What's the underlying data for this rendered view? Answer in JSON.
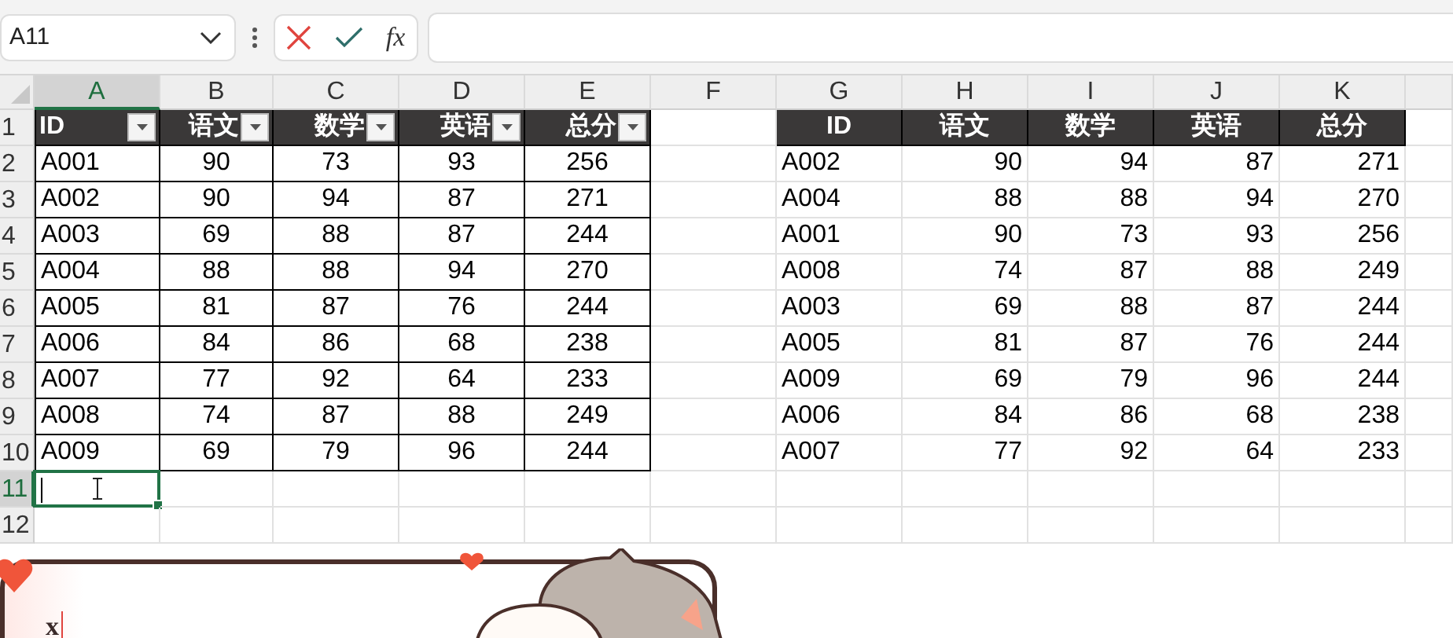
{
  "name_box": {
    "value": "A11"
  },
  "formula_bar": {
    "function_label": "fx"
  },
  "column_headers": [
    {
      "label": "A",
      "selected": true
    },
    {
      "label": "B",
      "selected": false
    },
    {
      "label": "C",
      "selected": false
    },
    {
      "label": "D",
      "selected": false
    },
    {
      "label": "E",
      "selected": false
    },
    {
      "label": "F",
      "selected": false
    },
    {
      "label": "G",
      "selected": false
    },
    {
      "label": "H",
      "selected": false
    },
    {
      "label": "I",
      "selected": false
    },
    {
      "label": "J",
      "selected": false
    },
    {
      "label": "K",
      "selected": false
    }
  ],
  "row_headers": [
    {
      "label": "1",
      "selected": false
    },
    {
      "label": "2",
      "selected": false
    },
    {
      "label": "3",
      "selected": false
    },
    {
      "label": "4",
      "selected": false
    },
    {
      "label": "5",
      "selected": false
    },
    {
      "label": "6",
      "selected": false
    },
    {
      "label": "7",
      "selected": false
    },
    {
      "label": "8",
      "selected": false
    },
    {
      "label": "9",
      "selected": false
    },
    {
      "label": "10",
      "selected": false
    },
    {
      "label": "11",
      "selected": true
    },
    {
      "label": "12",
      "selected": false
    }
  ],
  "score_table": {
    "headers": [
      "ID",
      "语文",
      "数学",
      "英语",
      "总分"
    ],
    "rows": [
      [
        "A001",
        "90",
        "73",
        "93",
        "256"
      ],
      [
        "A002",
        "90",
        "94",
        "87",
        "271"
      ],
      [
        "A003",
        "69",
        "88",
        "87",
        "244"
      ],
      [
        "A004",
        "88",
        "88",
        "94",
        "270"
      ],
      [
        "A005",
        "81",
        "87",
        "76",
        "244"
      ],
      [
        "A006",
        "84",
        "86",
        "68",
        "238"
      ],
      [
        "A007",
        "77",
        "92",
        "64",
        "233"
      ],
      [
        "A008",
        "74",
        "87",
        "88",
        "249"
      ],
      [
        "A009",
        "69",
        "79",
        "96",
        "244"
      ]
    ]
  },
  "sorted_table": {
    "headers": [
      "ID",
      "语文",
      "数学",
      "英语",
      "总分"
    ],
    "rows": [
      [
        "A002",
        "90",
        "94",
        "87",
        "271"
      ],
      [
        "A004",
        "88",
        "88",
        "94",
        "270"
      ],
      [
        "A001",
        "90",
        "73",
        "93",
        "256"
      ],
      [
        "A008",
        "74",
        "87",
        "88",
        "249"
      ],
      [
        "A003",
        "69",
        "88",
        "87",
        "244"
      ],
      [
        "A005",
        "81",
        "87",
        "76",
        "244"
      ],
      [
        "A009",
        "69",
        "79",
        "96",
        "244"
      ],
      [
        "A006",
        "84",
        "86",
        "68",
        "238"
      ],
      [
        "A007",
        "77",
        "92",
        "64",
        "233"
      ]
    ]
  },
  "note": {
    "text": "x"
  }
}
